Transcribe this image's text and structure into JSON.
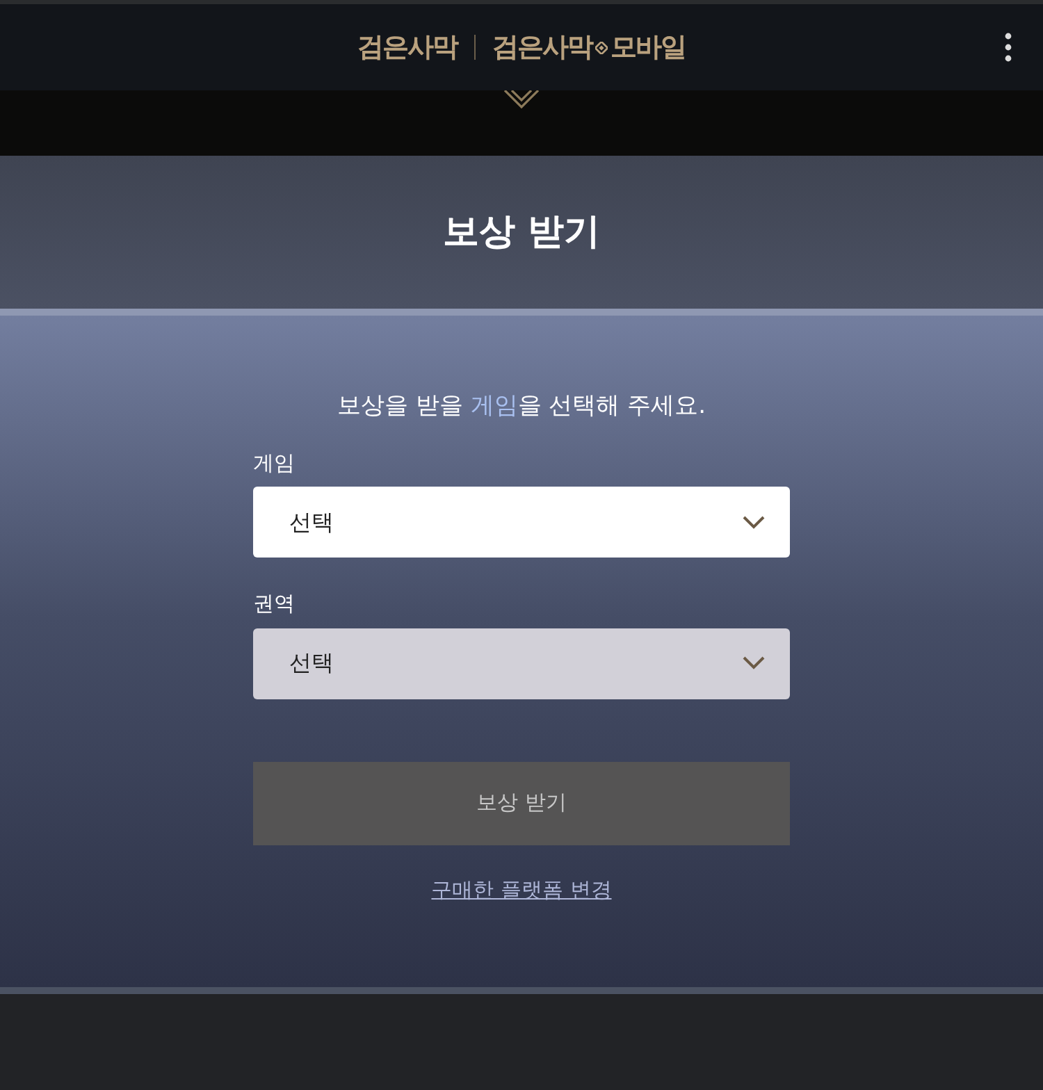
{
  "header": {
    "logo_text": "검은사막",
    "logo_mobile_left": "검은사막",
    "logo_mobile_right": "모바일"
  },
  "page_title": "보상 받기",
  "prompt": [
    {
      "text": "보상을 받을 ",
      "highlight": false
    },
    {
      "text": "게임",
      "highlight": true
    },
    {
      "text": "을 선택해 주세요.",
      "highlight": false
    }
  ],
  "fields": [
    {
      "label": "게임",
      "value": "선택",
      "disabled": false
    },
    {
      "label": "권역",
      "value": "선택",
      "disabled": true
    }
  ],
  "submit": {
    "label": "보상 받기",
    "disabled": true
  },
  "link": "구매한 플랫폼 변경"
}
